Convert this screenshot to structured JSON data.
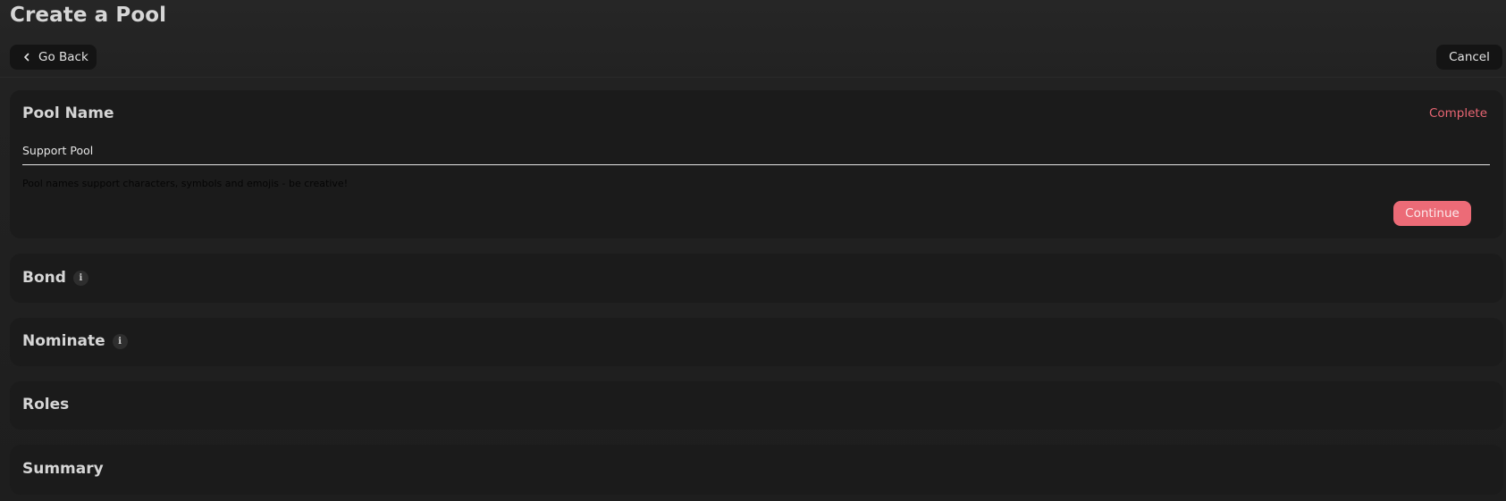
{
  "page": {
    "title": "Create a Pool"
  },
  "header": {
    "go_back_label": "Go Back",
    "cancel_label": "Cancel"
  },
  "sections": {
    "pool_name": {
      "title": "Pool Name",
      "status": "Complete",
      "input_value": "Support Pool",
      "helper": "Pool names support characters, symbols and emojis - be creative!",
      "continue_label": "Continue"
    },
    "bond": {
      "title": "Bond",
      "info_icon": "info-icon"
    },
    "nominate": {
      "title": "Nominate",
      "info_icon": "info-icon"
    },
    "roles": {
      "title": "Roles"
    },
    "summary": {
      "title": "Summary"
    }
  },
  "colors": {
    "accent": "#ec6b77",
    "complete": "#e96673",
    "card_bg": "#1b1b1b",
    "page_bg": "#242424"
  }
}
